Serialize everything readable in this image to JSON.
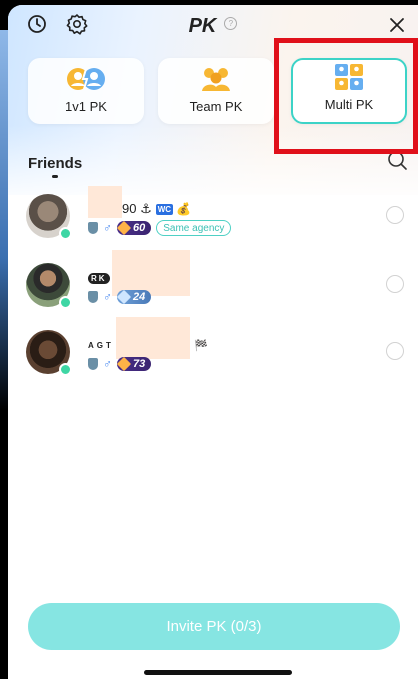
{
  "header": {
    "title": "PK",
    "help_glyph": "?",
    "history_icon": "clock-icon",
    "settings_icon": "gear-icon",
    "close_icon": "close-icon"
  },
  "modes": [
    {
      "label": "1v1 PK",
      "icon": "duo-users-icon",
      "active": false
    },
    {
      "label": "Team PK",
      "icon": "team-users-icon",
      "active": false
    },
    {
      "label": "Multi PK",
      "icon": "grid-users-icon",
      "active": true
    }
  ],
  "friends_section": {
    "title": "Friends",
    "search_icon": "search-icon"
  },
  "friends": [
    {
      "name": "90 ⚓",
      "level": "60",
      "tag": "Same agency",
      "extra": "💰"
    },
    {
      "name": "",
      "prefix": "RK",
      "level": "24"
    },
    {
      "name": "",
      "prefix": "AGT",
      "level": "73",
      "flag": "🏁"
    }
  ],
  "invite_button": {
    "label": "Invite PK (0/3)"
  },
  "colors": {
    "accent": "#3cd3c7",
    "invite_bg": "#86e5e2",
    "highlight": "#e0101a",
    "online": "#3ed6a4"
  }
}
